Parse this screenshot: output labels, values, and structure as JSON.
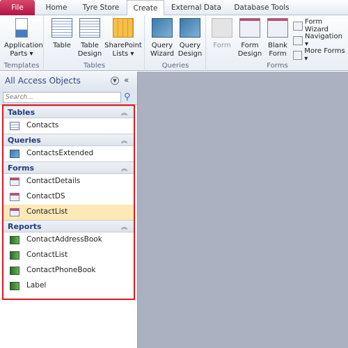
{
  "tabs": [
    "File",
    "Home",
    "Tyre Store",
    "Create",
    "External Data",
    "Database Tools"
  ],
  "active_tab": "Create",
  "ribbon": {
    "templates": {
      "label": "Templates",
      "buttons": [
        "Application Parts ▾"
      ]
    },
    "tables": {
      "label": "Tables",
      "buttons": [
        "Table",
        "Table Design",
        "SharePoint Lists ▾"
      ]
    },
    "queries": {
      "label": "Queries",
      "buttons": [
        "Query Wizard",
        "Query Design"
      ]
    },
    "forms": {
      "label": "Forms",
      "buttons": [
        "Form",
        "Form Design",
        "Blank Form"
      ],
      "small": [
        "Form Wizard",
        "Navigation ▾",
        "More Forms ▾"
      ]
    }
  },
  "nav": {
    "title": "All Access Objects",
    "search_placeholder": "Search...",
    "groups": [
      {
        "name": "Tables",
        "icon": "table",
        "items": [
          "Contacts"
        ]
      },
      {
        "name": "Queries",
        "icon": "query",
        "items": [
          "ContactsExtended"
        ]
      },
      {
        "name": "Forms",
        "icon": "form",
        "items": [
          "ContactDetails",
          "ContactDS",
          "ContactList"
        ]
      },
      {
        "name": "Reports",
        "icon": "report",
        "items": [
          "ContactAddressBook",
          "ContactList",
          "ContactPhoneBook",
          "Label"
        ]
      }
    ],
    "selected": {
      "group": "Forms",
      "item": "ContactList"
    }
  },
  "colors": {
    "highlight_box": "#e8141c",
    "selected_row": "#fde8b7",
    "file_tab": "#c0245a"
  }
}
